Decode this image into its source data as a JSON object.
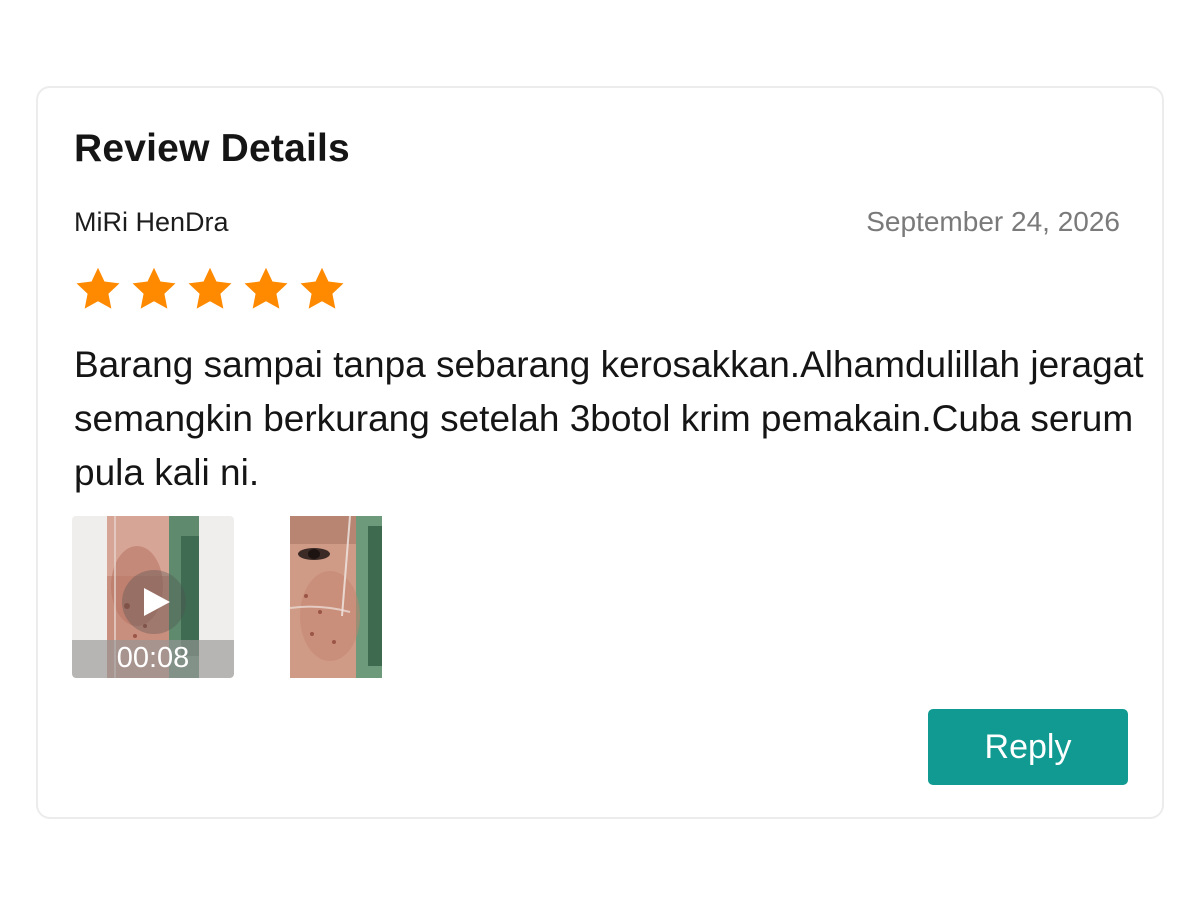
{
  "card": {
    "title": "Review Details"
  },
  "review": {
    "reviewer_name": "MiRi HenDra",
    "date": "September 24, 2026",
    "rating": 5,
    "rating_max": 5,
    "comment": "Barang sampai tanpa sebarang kerosakkan.Alhamdulillah jeragat semangkin berkurang setelah 3botol krim pemakain.Cuba serum pula kali ni.",
    "media": {
      "video_duration": "00:08"
    }
  },
  "actions": {
    "reply_label": "Reply"
  },
  "colors": {
    "star": "#ff8a00",
    "reply_button": "#109a91",
    "date_text": "#7a7a7a"
  },
  "icons": {
    "rating": "star-icon",
    "video": "play-icon"
  }
}
